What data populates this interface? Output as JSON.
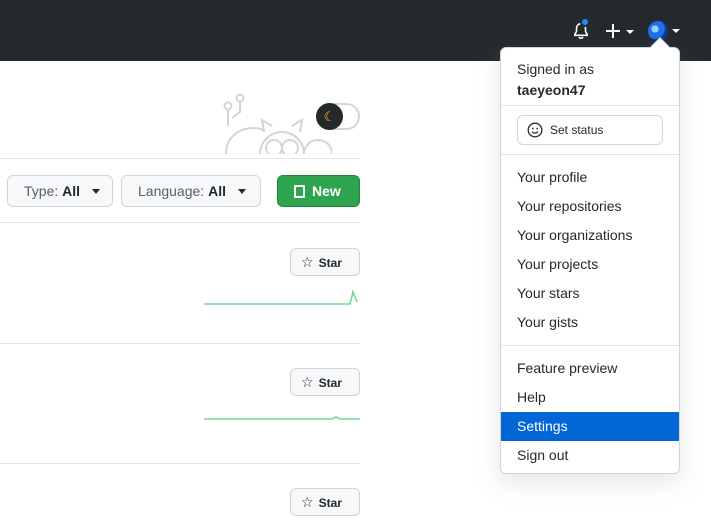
{
  "header": {
    "notifications_icon": "bell-icon",
    "create_icon": "plus-icon",
    "avatar_icon": "avatar-icon"
  },
  "filters": {
    "type_label": "Type:",
    "type_value": "All",
    "language_label": "Language:",
    "language_value": "All",
    "new_label": "New"
  },
  "repos": [
    {
      "star_label": "Star"
    },
    {
      "star_label": "Star"
    },
    {
      "star_label": "Star"
    }
  ],
  "dropdown": {
    "signed_in_as": "Signed in as",
    "username": "taeyeon47",
    "set_status": "Set status",
    "group1": [
      "Your profile",
      "Your repositories",
      "Your organizations",
      "Your projects",
      "Your stars",
      "Your gists"
    ],
    "group2": [
      "Feature preview",
      "Help",
      "Settings",
      "Sign out"
    ],
    "active_item": "Settings"
  },
  "colors": {
    "topbar": "#24292e",
    "accent": "#0366d6",
    "new_button": "#2ea44f",
    "sparkline": "#40c463",
    "notification_dot": "#2188ff"
  }
}
